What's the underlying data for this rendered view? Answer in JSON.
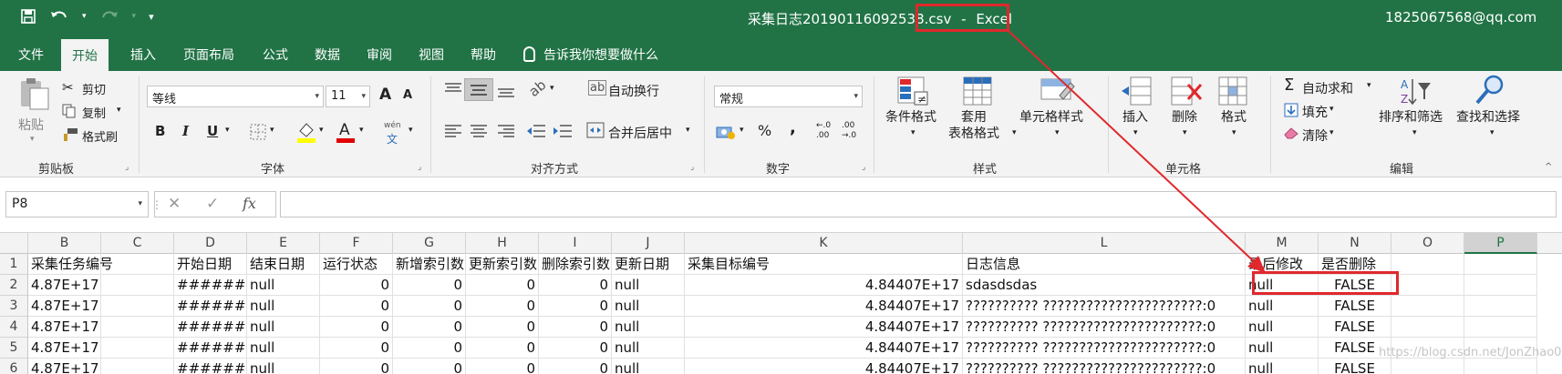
{
  "titlebar": {
    "filename": "采集日志20190116092538.csv",
    "app_separator": "-",
    "app_name": "Excel",
    "account": "1825067568@qq.com",
    "save_icon": "save-icon",
    "undo_icon": "undo-icon",
    "redo_icon": "redo-icon"
  },
  "tabs": [
    {
      "label": "文件"
    },
    {
      "label": "开始"
    },
    {
      "label": "插入"
    },
    {
      "label": "页面布局"
    },
    {
      "label": "公式"
    },
    {
      "label": "数据"
    },
    {
      "label": "审阅"
    },
    {
      "label": "视图"
    },
    {
      "label": "帮助"
    }
  ],
  "tellme": "告诉我你想要做什么",
  "ribbon": {
    "clipboard": {
      "paste": "粘贴",
      "cut": "剪切",
      "copy": "复制",
      "format_painter": "格式刷",
      "group": "剪贴板"
    },
    "font": {
      "name": "等线",
      "size": "11",
      "bold": "B",
      "italic": "I",
      "underline": "U",
      "grow": "A",
      "shrink": "A",
      "phonetic": "wén",
      "group": "字体"
    },
    "alignment": {
      "wrap": "自动换行",
      "merge": "合并后居中",
      "group": "对齐方式"
    },
    "number": {
      "format": "常规",
      "percent": "%",
      "comma": ",",
      "inc": "←.0\n.00",
      "dec": ".00\n→.0",
      "group": "数字"
    },
    "styles": {
      "conditional": "条件格式",
      "table": "套用\n表格格式",
      "cell": "单元格样式",
      "group": "样式"
    },
    "cells": {
      "insert": "插入",
      "delete": "删除",
      "format": "格式",
      "group": "单元格"
    },
    "editing": {
      "autosum": "自动求和",
      "fill": "填充",
      "clear": "清除",
      "sort": "排序和筛选",
      "find": "查找和选择",
      "group": "编辑"
    }
  },
  "formula_bar": {
    "name_box": "P8",
    "cancel": "✕",
    "enter": "✓",
    "fx": "fx",
    "value": ""
  },
  "grid": {
    "columns": [
      "B",
      "C",
      "D",
      "E",
      "F",
      "G",
      "H",
      "I",
      "J",
      "K",
      "L",
      "M",
      "N",
      "O",
      "P"
    ],
    "selected_column": "P",
    "rows": [
      "1",
      "2",
      "3",
      "4",
      "5",
      "6"
    ],
    "header_row": [
      "采集任务编号",
      "",
      "开始日期",
      "结束日期",
      "运行状态",
      "新增索引数",
      "更新索引数",
      "删除索引数",
      "更新日期",
      "采集目标编号",
      "日志信息",
      "最后修改",
      "是否删除",
      "",
      ""
    ],
    "data_rows": [
      [
        "4.87E+17",
        "",
        "######",
        "null",
        "0",
        "0",
        "0",
        "0",
        "null",
        "4.84407E+17",
        "sdasdsdas",
        "null",
        "FALSE",
        "",
        ""
      ],
      [
        "4.87E+17",
        "",
        "######",
        "null",
        "0",
        "0",
        "0",
        "0",
        "null",
        "4.84407E+17",
        "?????????? ??????????????????????:0",
        "null",
        "FALSE",
        "",
        ""
      ],
      [
        "4.87E+17",
        "",
        "######",
        "null",
        "0",
        "0",
        "0",
        "0",
        "null",
        "4.84407E+17",
        "?????????? ??????????????????????:0",
        "null",
        "FALSE",
        "",
        ""
      ],
      [
        "4.87E+17",
        "",
        "######",
        "null",
        "0",
        "0",
        "0",
        "0",
        "null",
        "4.84407E+17",
        "?????????? ??????????????????????:0",
        "null",
        "FALSE",
        "",
        ""
      ],
      [
        "4.87E+17",
        "",
        "######",
        "null",
        "0",
        "0",
        "0",
        "0",
        "null",
        "4.84407E+17",
        "?????????? ??????????????????????:0",
        "null",
        "FALSE",
        "",
        ""
      ]
    ]
  },
  "watermark": "https://blog.csdn.net/JonZhao09",
  "colors": {
    "excel_green": "#217346",
    "annotation_red": "#e0282d"
  }
}
